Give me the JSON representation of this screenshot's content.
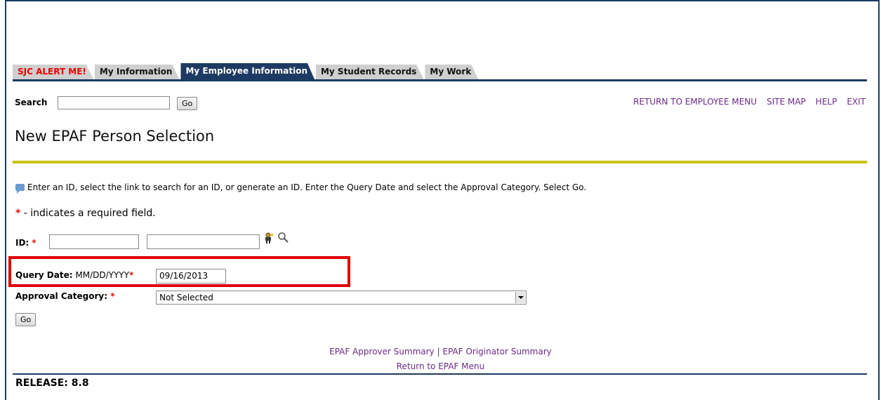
{
  "tabs": [
    {
      "label": "SJC ALERT ME!"
    },
    {
      "label": "My Information"
    },
    {
      "label": "My Employee Information"
    },
    {
      "label": "My Student Records"
    },
    {
      "label": "My Work"
    }
  ],
  "search": {
    "label": "Search",
    "value": "",
    "go_label": "Go"
  },
  "top_links": {
    "return_employee_menu": "RETURN TO EMPLOYEE MENU",
    "site_map": "SITE MAP",
    "help": "HELP",
    "exit": "EXIT"
  },
  "page_title": "New EPAF Person Selection",
  "info_text": "Enter an ID, select the link to search for an ID, or generate an ID. Enter the Query Date and select the Approval Category. Select Go.",
  "required_note": {
    "star": "*",
    "text": "- indicates a required field."
  },
  "form": {
    "id_label": "ID:",
    "required_star": "*",
    "query_date_label": "Query Date:",
    "query_date_format": "MM/DD/YYYY",
    "query_date_value": "09/16/2013",
    "approval_category_label": "Approval Category:",
    "approval_category_value": "Not Selected",
    "go_label": "Go"
  },
  "footer": {
    "approver_summary": "EPAF Approver Summary",
    "separator": "|",
    "originator_summary": "EPAF Originator Summary",
    "return_epaf_menu": "Return to EPAF Menu",
    "release": "RELEASE: 8.8"
  },
  "colors": {
    "tab_active": "#1d3a62",
    "rule": "#c9c200",
    "link": "#6b2a86",
    "required": "#e01010",
    "highlight": "#e00000"
  }
}
